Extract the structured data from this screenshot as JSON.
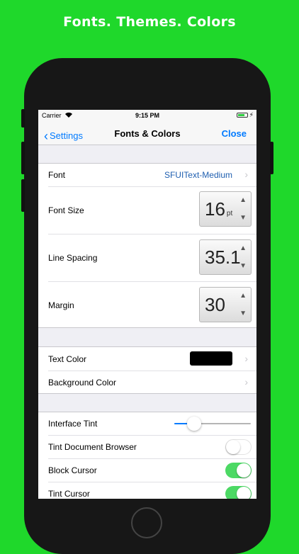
{
  "promo": {
    "headline": "Fonts. Themes. Colors"
  },
  "status_bar": {
    "carrier": "Carrier",
    "time": "9:15 PM",
    "wifi_icon": "wifi-icon",
    "battery_icon": "battery-icon"
  },
  "nav": {
    "back_label": "Settings",
    "title": "Fonts & Colors",
    "close_label": "Close"
  },
  "font_section": {
    "font": {
      "label": "Font",
      "value": "SFUIText-Medium"
    },
    "font_size": {
      "label": "Font Size",
      "value": "16",
      "unit": "pt"
    },
    "line_spacing": {
      "label": "Line Spacing",
      "value": "35.1"
    },
    "margin": {
      "label": "Margin",
      "value": "30"
    }
  },
  "color_section": {
    "text_color": {
      "label": "Text Color",
      "swatch": "#000000"
    },
    "background_color": {
      "label": "Background Color"
    }
  },
  "interface_section": {
    "interface_tint": {
      "label": "Interface Tint",
      "slider_value": 0.26
    },
    "tint_document_browser": {
      "label": "Tint Document Browser",
      "on": false
    },
    "block_cursor": {
      "label": "Block Cursor",
      "on": true
    },
    "tint_cursor": {
      "label": "Tint Cursor",
      "on": true
    }
  },
  "colors": {
    "accent": "#007aff",
    "switch_on": "#4cd964",
    "promo_bg": "#1fd82b"
  }
}
